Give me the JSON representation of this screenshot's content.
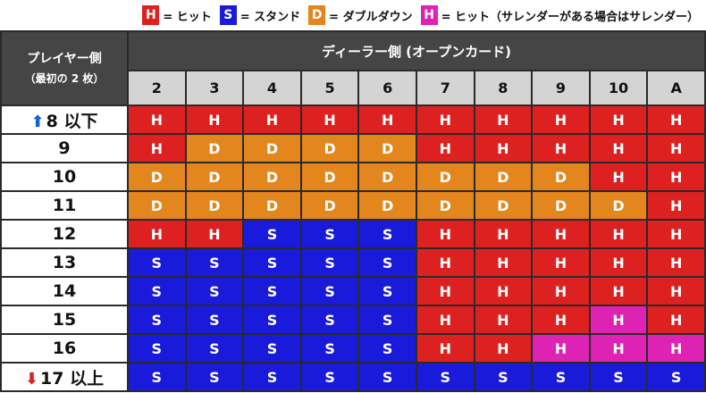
{
  "colors": {
    "H": "#dd2020",
    "S": "#1a1adb",
    "D": "#e3861e",
    "HS": "#de23b4"
  },
  "legend": [
    {
      "badge": "H",
      "type": "H",
      "text": "= ヒット"
    },
    {
      "badge": "S",
      "type": "S",
      "text": "= スタンド"
    },
    {
      "badge": "D",
      "type": "D",
      "text": "= ダブルダウン"
    },
    {
      "badge": "H",
      "type": "HS",
      "text": "= ヒット（サレンダーがある場合はサレンダー）"
    }
  ],
  "header": {
    "player_title": "プレイヤー側",
    "player_subtitle": "（最初の 2 枚）",
    "dealer_title": "ディーラー側 (オープンカード)",
    "dealer_cards": [
      "2",
      "3",
      "4",
      "5",
      "6",
      "7",
      "8",
      "9",
      "10",
      "A"
    ]
  },
  "rows": [
    {
      "label": "8 以下",
      "arrow": "up",
      "cells": [
        "H",
        "H",
        "H",
        "H",
        "H",
        "H",
        "H",
        "H",
        "H",
        "H"
      ]
    },
    {
      "label": "9",
      "cells": [
        "H",
        "D",
        "D",
        "D",
        "D",
        "H",
        "H",
        "H",
        "H",
        "H"
      ]
    },
    {
      "label": "10",
      "cells": [
        "D",
        "D",
        "D",
        "D",
        "D",
        "D",
        "D",
        "D",
        "H",
        "H"
      ]
    },
    {
      "label": "11",
      "cells": [
        "D",
        "D",
        "D",
        "D",
        "D",
        "D",
        "D",
        "D",
        "D",
        "H"
      ]
    },
    {
      "label": "12",
      "cells": [
        "H",
        "H",
        "S",
        "S",
        "S",
        "H",
        "H",
        "H",
        "H",
        "H"
      ]
    },
    {
      "label": "13",
      "cells": [
        "S",
        "S",
        "S",
        "S",
        "S",
        "H",
        "H",
        "H",
        "H",
        "H"
      ]
    },
    {
      "label": "14",
      "cells": [
        "S",
        "S",
        "S",
        "S",
        "S",
        "H",
        "H",
        "H",
        "H",
        "H"
      ]
    },
    {
      "label": "15",
      "cells": [
        "S",
        "S",
        "S",
        "S",
        "S",
        "H",
        "H",
        "H",
        "HS",
        "H"
      ]
    },
    {
      "label": "16",
      "cells": [
        "S",
        "S",
        "S",
        "S",
        "S",
        "H",
        "H",
        "HS",
        "HS",
        "HS"
      ]
    },
    {
      "label": "17 以上",
      "arrow": "down",
      "cells": [
        "S",
        "S",
        "S",
        "S",
        "S",
        "S",
        "S",
        "S",
        "S",
        "S"
      ]
    }
  ],
  "cell_text": {
    "H": "H",
    "S": "S",
    "D": "D",
    "HS": "H"
  }
}
